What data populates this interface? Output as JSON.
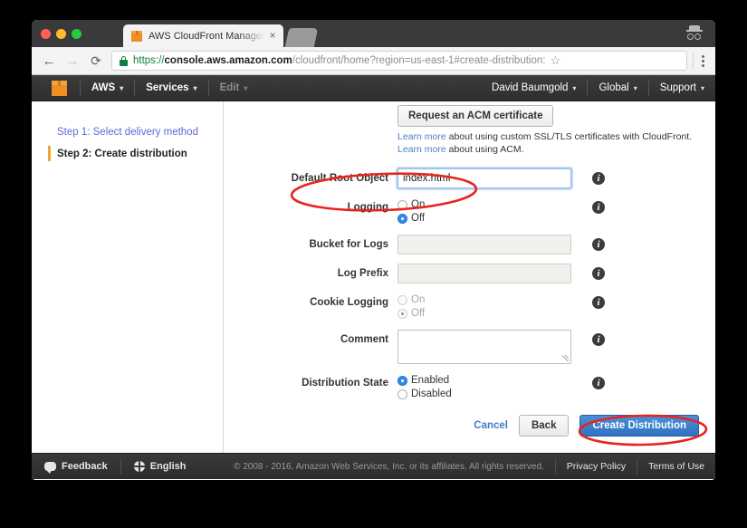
{
  "browser": {
    "tab": {
      "title": "AWS CloudFront Management",
      "favicon": "aws-cube-icon",
      "close": "×"
    },
    "toolbar": {
      "back": "←",
      "forward": "→",
      "reload": "⟳",
      "lock": "lock-icon",
      "url_scheme": "https://",
      "url_host": "console.aws.amazon.com",
      "url_path": "/cloudfront/home?region=us-east-1#create-distribution:",
      "star": "☆",
      "menu": "kebab-menu-icon"
    },
    "incognito": "incognito-icon"
  },
  "awsnav": {
    "logo": "aws-cube-logo",
    "items": [
      {
        "label": "AWS",
        "caret": "▾"
      },
      {
        "label": "Services",
        "caret": "▾"
      },
      {
        "label": "Edit",
        "caret": "▾"
      }
    ],
    "right": [
      {
        "label": "David Baumgold",
        "caret": "▾"
      },
      {
        "label": "Global",
        "caret": "▾"
      },
      {
        "label": "Support",
        "caret": "▾"
      }
    ]
  },
  "sidebar": {
    "steps": [
      {
        "label": "Step 1: Select delivery method",
        "state": "done"
      },
      {
        "label": "Step 2: Create distribution",
        "state": "current"
      }
    ]
  },
  "form": {
    "acm_button": "Request an ACM certificate",
    "learn_more_1": {
      "link": "Learn more",
      "text": " about using custom SSL/TLS certificates with CloudFront."
    },
    "learn_more_2": {
      "link": "Learn more",
      "text": " about using ACM."
    },
    "fields": [
      {
        "label": "Default Root Object",
        "type": "text",
        "value": "index.html",
        "placeholder": "",
        "disabled": false,
        "focused": true
      },
      {
        "label": "Logging",
        "type": "radio",
        "options": [
          "On",
          "Off"
        ],
        "selected": "Off",
        "disabled": false
      },
      {
        "label": "Bucket for Logs",
        "type": "text",
        "value": "",
        "placeholder": "",
        "disabled": true,
        "focused": false
      },
      {
        "label": "Log Prefix",
        "type": "text",
        "value": "",
        "placeholder": "",
        "disabled": true,
        "focused": false
      },
      {
        "label": "Cookie Logging",
        "type": "radio",
        "options": [
          "On",
          "Off"
        ],
        "selected": "Off",
        "disabled": true
      },
      {
        "label": "Comment",
        "type": "textarea",
        "value": "",
        "placeholder": "",
        "disabled": false
      },
      {
        "label": "Distribution State",
        "type": "radio",
        "options": [
          "Enabled",
          "Disabled"
        ],
        "selected": "Enabled",
        "disabled": false
      }
    ],
    "info_icon": "i",
    "actions": {
      "cancel": "Cancel",
      "back": "Back",
      "create": "Create Distribution"
    }
  },
  "footer": {
    "feedback": "Feedback",
    "language": "English",
    "copyright": "© 2008 - 2016, Amazon Web Services, Inc. or its affiliates. All rights reserved.",
    "privacy": "Privacy Policy",
    "terms": "Terms of Use"
  },
  "annotations": {
    "color": "#e8241f",
    "shapes": [
      {
        "name": "default-root-object-highlight"
      },
      {
        "name": "create-distribution-highlight"
      }
    ]
  }
}
